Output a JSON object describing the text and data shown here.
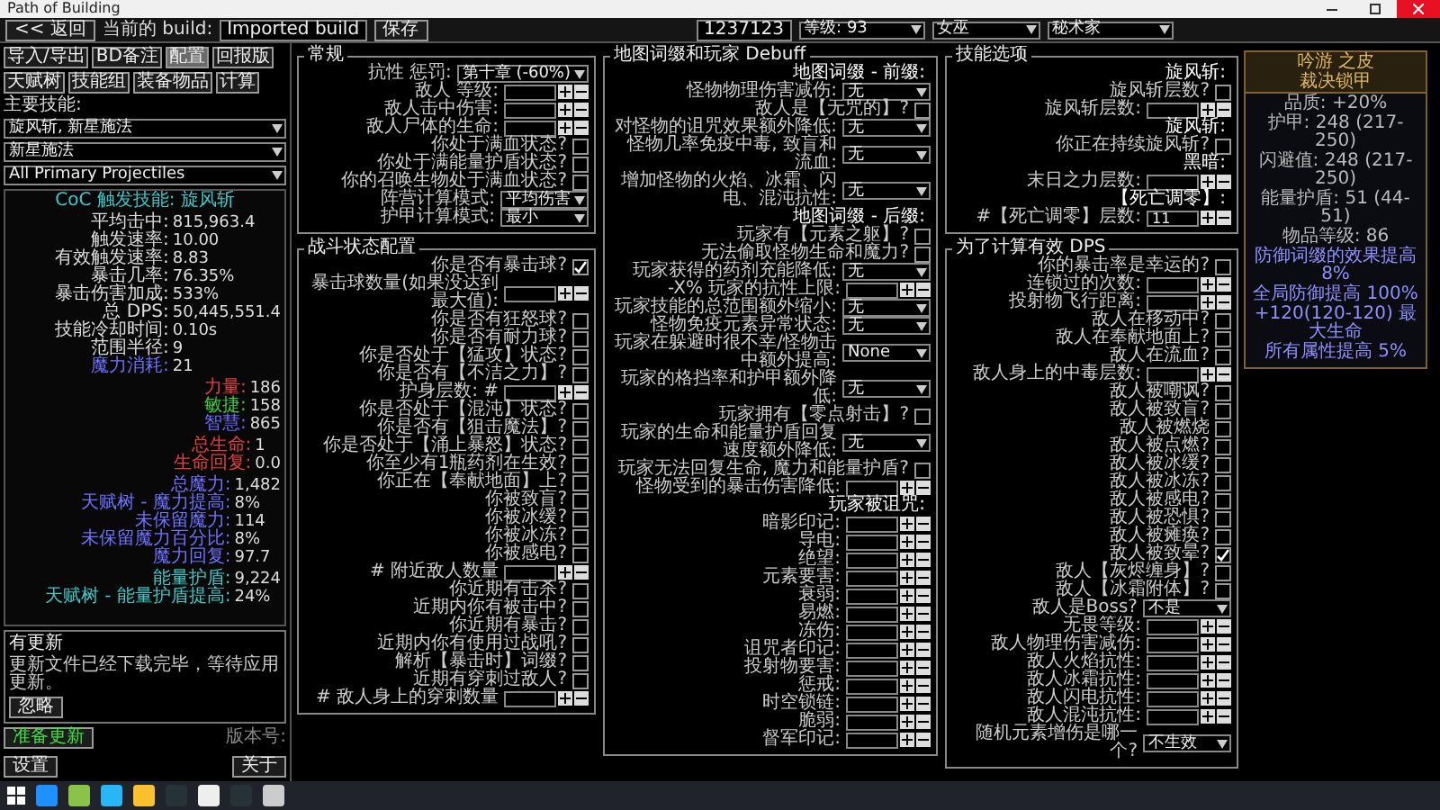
{
  "window": {
    "title": "Path of Building"
  },
  "toolbar": {
    "back": "<< 返回",
    "build_label": "当前的 build:",
    "build_name": "Imported build",
    "save": "保存",
    "points": "1237123",
    "level": "等级: 93",
    "class": "女巫",
    "ascendancy": "秘术家"
  },
  "tabs": [
    {
      "label": "导入/导出",
      "selected": false
    },
    {
      "label": "BD备注",
      "selected": false
    },
    {
      "label": "配置",
      "selected": true
    },
    {
      "label": "回报版",
      "selected": false
    },
    {
      "label": "天赋树",
      "selected": false
    },
    {
      "label": "技能组",
      "selected": false
    },
    {
      "label": "装备物品",
      "selected": false
    },
    {
      "label": "计算",
      "selected": false
    }
  ],
  "main_skill": {
    "label": "主要技能:",
    "selects": [
      "旋风斩, 新星施法",
      "新星施法",
      "All Primary Projectiles"
    ]
  },
  "stats": {
    "title": "CoC 触发技能: 旋风斩",
    "groups": [
      [
        {
          "label": "平均击中:",
          "value": "815,963.4"
        },
        {
          "label": "触发速率:",
          "value": "10.00"
        },
        {
          "label": "有效触发速率:",
          "value": "8.83"
        },
        {
          "label": "暴击几率:",
          "value": "76.35%"
        },
        {
          "label": "暴击伤害加成:",
          "value": "533%"
        },
        {
          "label": "总 DPS:",
          "value": "50,445,551.4"
        },
        {
          "label": "技能冷却时间:",
          "value": "0.10s"
        },
        {
          "label": "范围半径:",
          "value": "9"
        },
        {
          "label": "魔力消耗:",
          "value": "21",
          "color": "#7070ff"
        }
      ],
      [
        {
          "label": "力量:",
          "value": "186",
          "color": "#e04040"
        },
        {
          "label": "敏捷:",
          "value": "158",
          "color": "#40d040"
        },
        {
          "label": "智慧:",
          "value": "865",
          "color": "#6a6aff"
        }
      ],
      [
        {
          "label": "总生命:",
          "value": "1",
          "color": "#e04040"
        },
        {
          "label": "生命回复:",
          "value": "0.0",
          "color": "#e04040"
        }
      ],
      [
        {
          "label": "总魔力:",
          "value": "1,482",
          "color": "#7070ff"
        },
        {
          "label": "天赋树 - 魔力提高:",
          "value": "8%",
          "color": "#7070ff"
        },
        {
          "label": "未保留魔力:",
          "value": "114",
          "color": "#7070ff"
        },
        {
          "label": "未保留魔力百分比:",
          "value": "8%",
          "color": "#7070ff"
        },
        {
          "label": "魔力回复:",
          "value": "97.7",
          "color": "#7070ff"
        }
      ],
      [
        {
          "label": "能量护盾:",
          "value": "9,224",
          "color": "#40c8c8"
        },
        {
          "label": "天赋树 - 能量护盾提高:",
          "value": "24%",
          "color": "#40c8c8"
        }
      ]
    ]
  },
  "update": {
    "title": "有更新",
    "message": "更新文件已经下载完毕，等待应用更新。",
    "ignore": "忽略",
    "apply": "准备更新",
    "version": "版本号:",
    "settings": "设置",
    "about": "关于"
  },
  "columns": [
    [
      {
        "title": "常规",
        "rows": [
          {
            "kind": "select",
            "label": "抗性 惩罚:",
            "value": "第十章 (-60%)"
          },
          {
            "kind": "number",
            "label": "敌人 等级:"
          },
          {
            "kind": "number",
            "label": "敌人击中伤害:"
          },
          {
            "kind": "number",
            "label": "敌人尸体的生命:"
          },
          {
            "kind": "check",
            "label": "你处于满血状态?",
            "checked": false
          },
          {
            "kind": "check",
            "label": "你处于满能量护盾状态?",
            "checked": false
          },
          {
            "kind": "check",
            "label": "你的召唤生物处于满血状态?",
            "checked": false
          },
          {
            "kind": "select",
            "label": "阵营计算模式:",
            "value": "平均伤害"
          },
          {
            "kind": "select",
            "label": "护甲计算模式:",
            "value": "最小"
          }
        ]
      },
      {
        "title": "战斗状态配置",
        "rows": [
          {
            "kind": "check",
            "label": "你是否有暴击球?",
            "checked": true
          },
          {
            "kind": "number",
            "label": "暴击球数量(如果没达到最大值):"
          },
          {
            "kind": "check",
            "label": "你是否有狂怒球?",
            "checked": false
          },
          {
            "kind": "check",
            "label": "你是否有耐力球?",
            "checked": false
          },
          {
            "kind": "check",
            "label": "你是否处于【猛攻】状态?",
            "checked": false
          },
          {
            "kind": "check",
            "label": "你是否有【不洁之力】?",
            "checked": false
          },
          {
            "kind": "number",
            "label": "护身层数: #"
          },
          {
            "kind": "check",
            "label": "你是否处于【混沌】状态?",
            "checked": false
          },
          {
            "kind": "check",
            "label": "你是否有【狙击魔法】?",
            "checked": false
          },
          {
            "kind": "check",
            "label": "你是否处于【涌上暴怒】状态?",
            "checked": false
          },
          {
            "kind": "check",
            "label": "你至少有1瓶药剂在生效?",
            "checked": false
          },
          {
            "kind": "check",
            "label": "你正在【奉献地面】上?",
            "checked": false
          },
          {
            "kind": "check",
            "label": "你被致盲?",
            "checked": false
          },
          {
            "kind": "check",
            "label": "你被冰缓?",
            "checked": false
          },
          {
            "kind": "check",
            "label": "你被冰冻?",
            "checked": false
          },
          {
            "kind": "check",
            "label": "你被感电?",
            "checked": false
          },
          {
            "kind": "number",
            "label": "# 附近敌人数量"
          },
          {
            "kind": "check",
            "label": "你近期有击杀?",
            "checked": false
          },
          {
            "kind": "check",
            "label": "近期内你有被击中?",
            "checked": false
          },
          {
            "kind": "check",
            "label": "你近期有暴击?",
            "checked": false
          },
          {
            "kind": "check",
            "label": "近期内你有使用过战吼?",
            "checked": false
          },
          {
            "kind": "check",
            "label": "解析【暴击时】词缀?",
            "checked": false
          },
          {
            "kind": "check",
            "label": "近期有穿刺过敌人?",
            "checked": false
          },
          {
            "kind": "number",
            "label": "# 敌人身上的穿刺数量"
          }
        ]
      }
    ],
    [
      {
        "title": "地图词缀和玩家 Debuff",
        "rows": [
          {
            "kind": "heading",
            "label": "地图词缀 - 前缀:"
          },
          {
            "kind": "select",
            "label": "怪物物理伤害减伤:",
            "value": "无"
          },
          {
            "kind": "check",
            "label": "敌人是【无咒的】?",
            "checked": false
          },
          {
            "kind": "select",
            "label": "对怪物的诅咒效果额外降低:",
            "value": "无"
          },
          {
            "kind": "select",
            "label": "怪物几率免疫中毒, 致盲和流血:",
            "value": "无"
          },
          {
            "kind": "select",
            "label": "增加怪物的火焰、冰霜、闪电、混沌抗性:",
            "value": "无"
          },
          {
            "kind": "heading",
            "label": "地图词缀 - 后缀:"
          },
          {
            "kind": "check",
            "label": "玩家有【元素之躯】?",
            "checked": false
          },
          {
            "kind": "check",
            "label": "无法偷取怪物生命和魔力?",
            "checked": false
          },
          {
            "kind": "select",
            "label": "玩家获得的药剂充能降低:",
            "value": "无"
          },
          {
            "kind": "number",
            "label": "-X% 玩家的抗性上限:"
          },
          {
            "kind": "select",
            "label": "玩家技能的总范围额外缩小:",
            "value": "无"
          },
          {
            "kind": "select",
            "label": "怪物免疫元素异常状态:",
            "value": "无"
          },
          {
            "kind": "select",
            "label": "玩家在躲避时很不幸/怪物击中额外提高:",
            "value": "None"
          },
          {
            "kind": "select",
            "label": "玩家的格挡率和护甲额外降低:",
            "value": "无"
          },
          {
            "kind": "check",
            "label": "玩家拥有【零点射击】?",
            "checked": false
          },
          {
            "kind": "select",
            "label": "玩家的生命和能量护盾回复速度额外降低:",
            "value": "无"
          },
          {
            "kind": "check",
            "label": "玩家无法回复生命, 魔力和能量护盾?",
            "checked": false
          },
          {
            "kind": "number",
            "label": "怪物受到的暴击伤害降低:"
          },
          {
            "kind": "heading",
            "label": "玩家被诅咒:"
          },
          {
            "kind": "number",
            "label": "暗影印记:"
          },
          {
            "kind": "number",
            "label": "导电:"
          },
          {
            "kind": "number",
            "label": "绝望:"
          },
          {
            "kind": "number",
            "label": "元素要害:"
          },
          {
            "kind": "number",
            "label": "衰弱:"
          },
          {
            "kind": "number",
            "label": "易燃:"
          },
          {
            "kind": "number",
            "label": "冻伤:"
          },
          {
            "kind": "number",
            "label": "诅咒者印记:"
          },
          {
            "kind": "number",
            "label": "投射物要害:"
          },
          {
            "kind": "number",
            "label": "惩戒:"
          },
          {
            "kind": "number",
            "label": "时空锁链:"
          },
          {
            "kind": "number",
            "label": "脆弱:"
          },
          {
            "kind": "number",
            "label": "督军印记:"
          }
        ]
      }
    ],
    [
      {
        "title": "技能选项",
        "rows": [
          {
            "kind": "heading",
            "label": "旋风斩:"
          },
          {
            "kind": "check",
            "label": "旋风斩层数?",
            "checked": false
          },
          {
            "kind": "number",
            "label": "旋风斩层数:"
          },
          {
            "kind": "heading",
            "label": "旋风斩:"
          },
          {
            "kind": "check",
            "label": "你正在持续旋风斩?",
            "checked": false
          },
          {
            "kind": "heading",
            "label": "黑暗:"
          },
          {
            "kind": "number",
            "label": "末日之力层数:"
          },
          {
            "kind": "heading",
            "label": "【死亡调零】:"
          },
          {
            "kind": "number",
            "label": "#【死亡调零】层数:",
            "value": "11"
          }
        ]
      },
      {
        "title": "为了计算有效 DPS",
        "rows": [
          {
            "kind": "check",
            "label": "你的暴击率是幸运的?",
            "checked": false
          },
          {
            "kind": "number",
            "label": "连锁过的次数:"
          },
          {
            "kind": "number",
            "label": "投射物飞行距离:"
          },
          {
            "kind": "check",
            "label": "敌人在移动中?",
            "checked": false
          },
          {
            "kind": "check",
            "label": "敌人在奉献地面上?",
            "checked": false
          },
          {
            "kind": "check",
            "label": "敌人在流血?",
            "checked": false
          },
          {
            "kind": "number",
            "label": "敌人身上的中毒层数:"
          },
          {
            "kind": "check",
            "label": "敌人被嘲讽?",
            "checked": false
          },
          {
            "kind": "check",
            "label": "敌人被致盲?",
            "checked": false
          },
          {
            "kind": "check",
            "label": "敌人被燃烧",
            "checked": false
          },
          {
            "kind": "check",
            "label": "敌人被点燃?",
            "checked": false
          },
          {
            "kind": "check",
            "label": "敌人被冰缓?",
            "checked": false
          },
          {
            "kind": "check",
            "label": "敌人被冰冻?",
            "checked": false
          },
          {
            "kind": "check",
            "label": "敌人被感电?",
            "checked": false
          },
          {
            "kind": "check",
            "label": "敌人被恐惧?",
            "checked": false
          },
          {
            "kind": "check",
            "label": "敌人被瘫痪?",
            "checked": false
          },
          {
            "kind": "check",
            "label": "敌人被致晕?",
            "checked": true
          },
          {
            "kind": "check",
            "label": "敌人【灰烬缠身】?",
            "checked": false
          },
          {
            "kind": "check",
            "label": "敌人【冰霜附体】?",
            "checked": false
          },
          {
            "kind": "select",
            "label": "敌人是Boss?",
            "value": "不是"
          },
          {
            "kind": "number",
            "label": "无畏等级:"
          },
          {
            "kind": "number",
            "label": "敌人物理伤害减伤:"
          },
          {
            "kind": "number",
            "label": "敌人火焰抗性:"
          },
          {
            "kind": "number",
            "label": "敌人冰霜抗性:"
          },
          {
            "kind": "number",
            "label": "敌人闪电抗性:"
          },
          {
            "kind": "number",
            "label": "敌人混沌抗性:"
          },
          {
            "kind": "select",
            "label": "随机元素增伤是哪一个?",
            "value": "不生效"
          }
        ]
      }
    ]
  ],
  "tooltip": {
    "title": [
      "吟游 之皮",
      "裁决锁甲"
    ],
    "lines": [
      {
        "kind": "property",
        "text": "品质: +20%"
      },
      {
        "kind": "property",
        "text": "护甲: 248 (217-250)"
      },
      {
        "kind": "property",
        "text": "闪避值: 248 (217-250)"
      },
      {
        "kind": "property",
        "text": "能量护盾: 51 (44-51)"
      },
      {
        "kind": "property",
        "text": "物品等级: 86"
      },
      {
        "kind": "mod",
        "text": "防御词缀的效果提高 8%"
      },
      {
        "kind": "mod",
        "text": "全局防御提高 100%"
      },
      {
        "kind": "mod",
        "text": "+120(120-120) 最大生命"
      },
      {
        "kind": "mod",
        "text": "所有属性提高 5%"
      }
    ]
  }
}
